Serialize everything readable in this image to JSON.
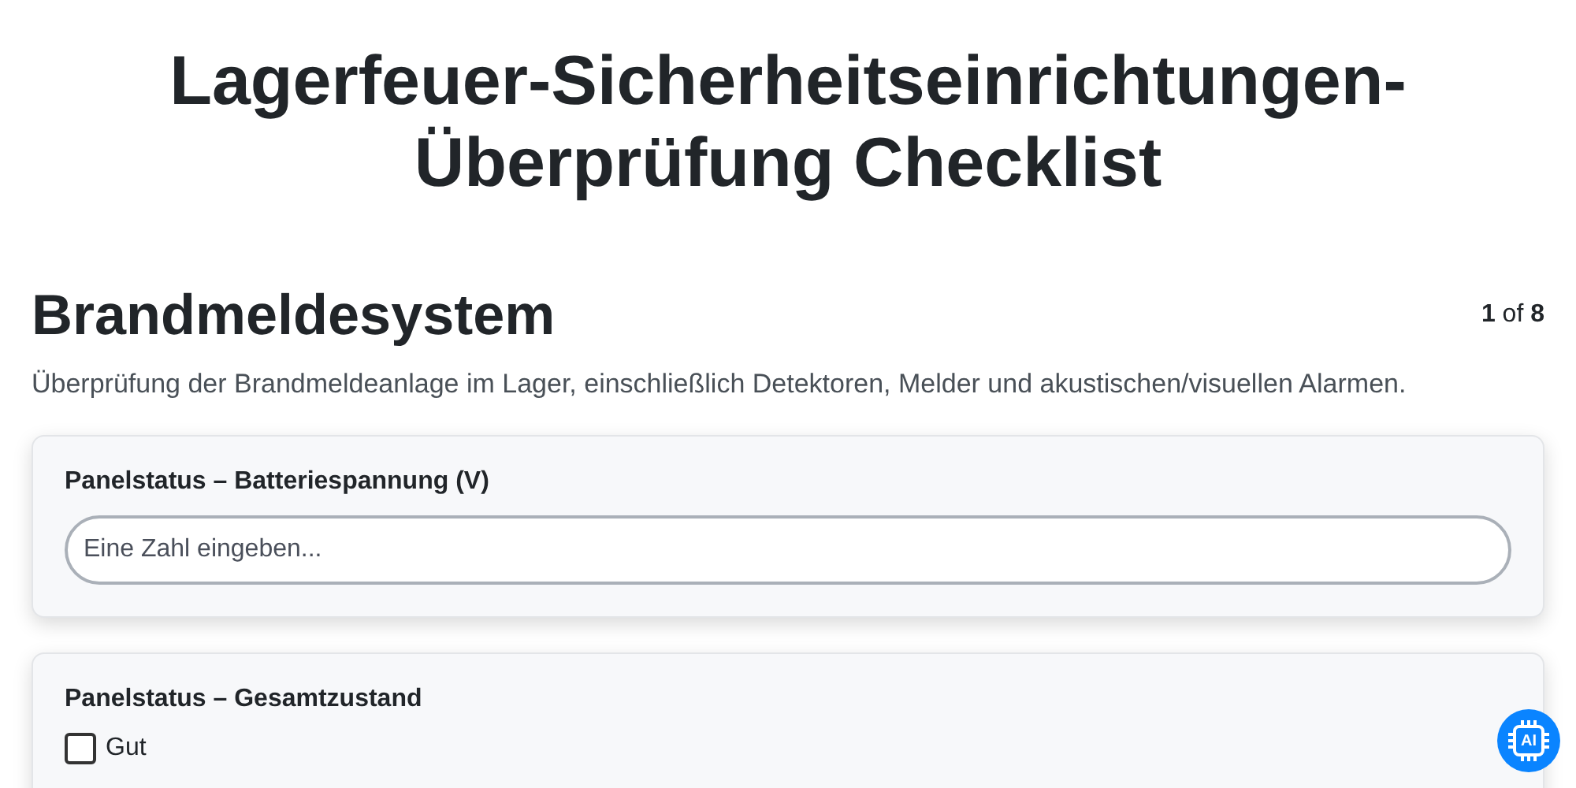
{
  "title": "Lagerfeuer-Sicherheitseinrichtungen-Überprüfung Checklist",
  "section": {
    "heading": "Brandmeldesystem",
    "counter": "**1** of **8**",
    "description": "Überprüfung der Brandmeldeanlage im Lager, einschließlich Detektoren, Melder und akustischen/visuellen Alarmen."
  },
  "questions": [
    {
      "kind": "number",
      "label": "Panelstatus – Batteriespannung (V)",
      "placeholder": "Eine Zahl eingeben..."
    },
    {
      "kind": "checkboxes",
      "label": "Panelstatus – Gesamtzustand",
      "options": [
        {
          "label": "Gut",
          "checked": false
        }
      ]
    }
  ],
  "ai_button": {
    "label": "AI"
  }
}
